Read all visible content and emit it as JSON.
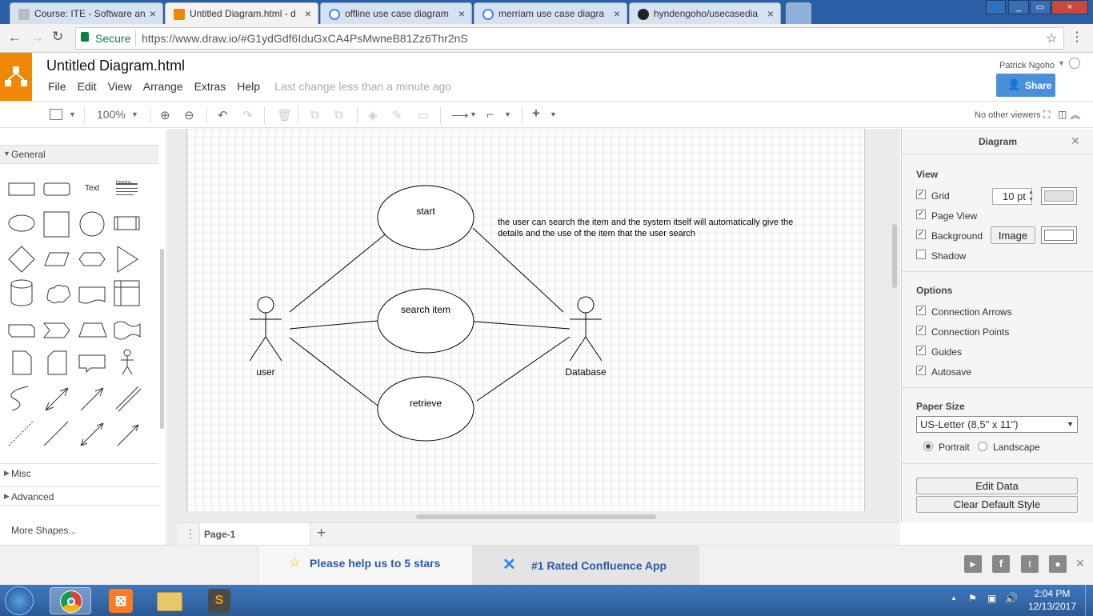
{
  "browser": {
    "tabs": [
      {
        "title": "Course: ITE - Software an",
        "fav_color": "#cccccc"
      },
      {
        "title": "Untitled Diagram.html - d",
        "fav_color": "#f08705",
        "active": true
      },
      {
        "title": "offline use case diagram",
        "fav_color": "#4285f4"
      },
      {
        "title": "merriam use case diagra",
        "fav_color": "#4285f4"
      },
      {
        "title": "hyndengoho/usecasedia",
        "fav_color": "#222222"
      }
    ],
    "secure_label": "Secure",
    "url": "https://www.draw.io/#G1ydGdf6IduGxCA4PsMwneB81Zz6Thr2nS",
    "close_symbol": "×",
    "min_symbol": "_",
    "max_symbol": "▭"
  },
  "app": {
    "doc_title": "Untitled Diagram.html",
    "menus": [
      "File",
      "Edit",
      "View",
      "Arrange",
      "Extras",
      "Help"
    ],
    "last_change": "Last change less than a minute ago",
    "user": "Patrick Ngoho",
    "share_label": "Share",
    "zoom": "100%",
    "viewers": "No other viewers",
    "accent": "#f08705",
    "share_color": "#4a90d9"
  },
  "left_panel": {
    "general_label": "General",
    "text_shape": "Text",
    "heading_shape": "Heading",
    "misc_label": "Misc",
    "advanced_label": "Advanced",
    "more_shapes": "More Shapes..."
  },
  "diagram": {
    "usecases": [
      "start",
      "search item",
      "retrieve"
    ],
    "actors": [
      "user",
      "Database"
    ],
    "note_line1": "the user can search the item and the system itself will automatically give the",
    "note_line2": "details and the use of the item that the user search"
  },
  "page_tab": "Page-1",
  "right_panel": {
    "title": "Diagram",
    "view_heading": "View",
    "grid_label": "Grid",
    "grid_size": "10 pt",
    "page_view_label": "Page View",
    "background_label": "Background",
    "image_button": "Image",
    "shadow_label": "Shadow",
    "options_heading": "Options",
    "connection_arrows": "Connection Arrows",
    "connection_points": "Connection Points",
    "guides": "Guides",
    "autosave": "Autosave",
    "paper_size_heading": "Paper Size",
    "paper_size": "US-Letter (8,5\" x 11\")",
    "portrait": "Portrait",
    "landscape": "Landscape",
    "edit_data": "Edit Data",
    "clear_default_style": "Clear Default Style"
  },
  "banner": {
    "rate_text": "Please help us to 5 stars",
    "confluence_text": "#1 Rated Confluence App"
  },
  "taskbar": {
    "time": "2:04 PM",
    "date": "12/13/2017"
  }
}
